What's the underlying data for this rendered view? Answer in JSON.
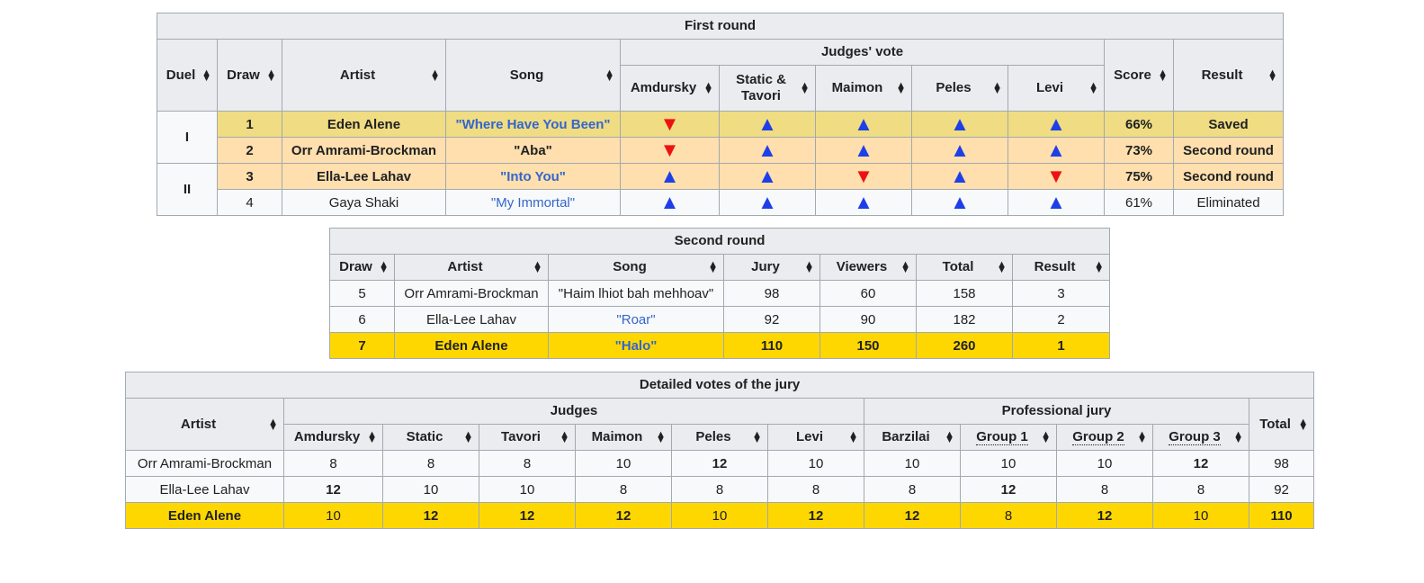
{
  "round1": {
    "caption": "First round",
    "headers": {
      "duel": "Duel",
      "draw": "Draw",
      "artist": "Artist",
      "song": "Song",
      "judges_vote": "Judges' vote",
      "amdursky": "Amdursky",
      "static_tavori_1": "Static &",
      "static_tavori_2": "Tavori",
      "maimon": "Maimon",
      "peles": "Peles",
      "levi": "Levi",
      "score": "Score",
      "result": "Result"
    },
    "duels": [
      "I",
      "II"
    ],
    "rows": [
      {
        "draw": "1",
        "artist": "Eden Alene",
        "song": "\"Where Have You Been\"",
        "votes": [
          "down",
          "up",
          "up",
          "up",
          "up"
        ],
        "score": "66%",
        "result": "Saved"
      },
      {
        "draw": "2",
        "artist": "Orr Amrami-Brockman",
        "song": "\"Aba\"",
        "votes": [
          "down",
          "up",
          "up",
          "up",
          "up"
        ],
        "score": "73%",
        "result": "Second round"
      },
      {
        "draw": "3",
        "artist": "Ella-Lee Lahav",
        "song": "\"Into You\"",
        "votes": [
          "up",
          "up",
          "down",
          "up",
          "down"
        ],
        "score": "75%",
        "result": "Second round"
      },
      {
        "draw": "4",
        "artist": "Gaya Shaki",
        "song": "\"My Immortal\"",
        "votes": [
          "up",
          "up",
          "up",
          "up",
          "up"
        ],
        "score": "61%",
        "result": "Eliminated"
      }
    ]
  },
  "round2": {
    "caption": "Second round",
    "headers": {
      "draw": "Draw",
      "artist": "Artist",
      "song": "Song",
      "jury": "Jury",
      "viewers": "Viewers",
      "total": "Total",
      "result": "Result"
    },
    "rows": [
      {
        "draw": "5",
        "artist": "Orr Amrami-Brockman",
        "song": "\"Haim lhiot bah mehhoav\"",
        "jury": "98",
        "viewers": "60",
        "total": "158",
        "result": "3"
      },
      {
        "draw": "6",
        "artist": "Ella-Lee Lahav",
        "song": "\"Roar\"",
        "jury": "92",
        "viewers": "90",
        "total": "182",
        "result": "2"
      },
      {
        "draw": "7",
        "artist": "Eden Alene",
        "song": "\"Halo\"",
        "jury": "110",
        "viewers": "150",
        "total": "260",
        "result": "1"
      }
    ]
  },
  "jury": {
    "caption": "Detailed votes of the jury",
    "headers": {
      "artist": "Artist",
      "judges": "Judges",
      "professional": "Professional jury",
      "total": "Total",
      "amdursky": "Amdursky",
      "static": "Static",
      "tavori": "Tavori",
      "maimon": "Maimon",
      "peles": "Peles",
      "levi": "Levi",
      "barzilai": "Barzilai",
      "group1": "Group 1",
      "group2": "Group 2",
      "group3": "Group 3"
    },
    "rows": [
      {
        "artist": "Orr Amrami-Brockman",
        "v": [
          "8",
          "8",
          "8",
          "10",
          "12",
          "10",
          "10",
          "10",
          "10",
          "12"
        ],
        "total": "98"
      },
      {
        "artist": "Ella-Lee Lahav",
        "v": [
          "12",
          "10",
          "10",
          "8",
          "8",
          "8",
          "8",
          "12",
          "8",
          "8"
        ],
        "total": "92"
      },
      {
        "artist": "Eden Alene",
        "v": [
          "10",
          "12",
          "12",
          "12",
          "10",
          "12",
          "12",
          "8",
          "12",
          "10"
        ],
        "total": "110"
      }
    ]
  },
  "icons": {
    "vote_up": "▲",
    "vote_down": "▼",
    "sort_up": "▲",
    "sort_down": "▼"
  },
  "colors": {
    "saved": "#f0dc82",
    "second_round": "#fedfad",
    "winner": "#ffd700",
    "vote_up": "#1e3fe8",
    "vote_down": "#ee1111",
    "link": "#3366cc"
  }
}
